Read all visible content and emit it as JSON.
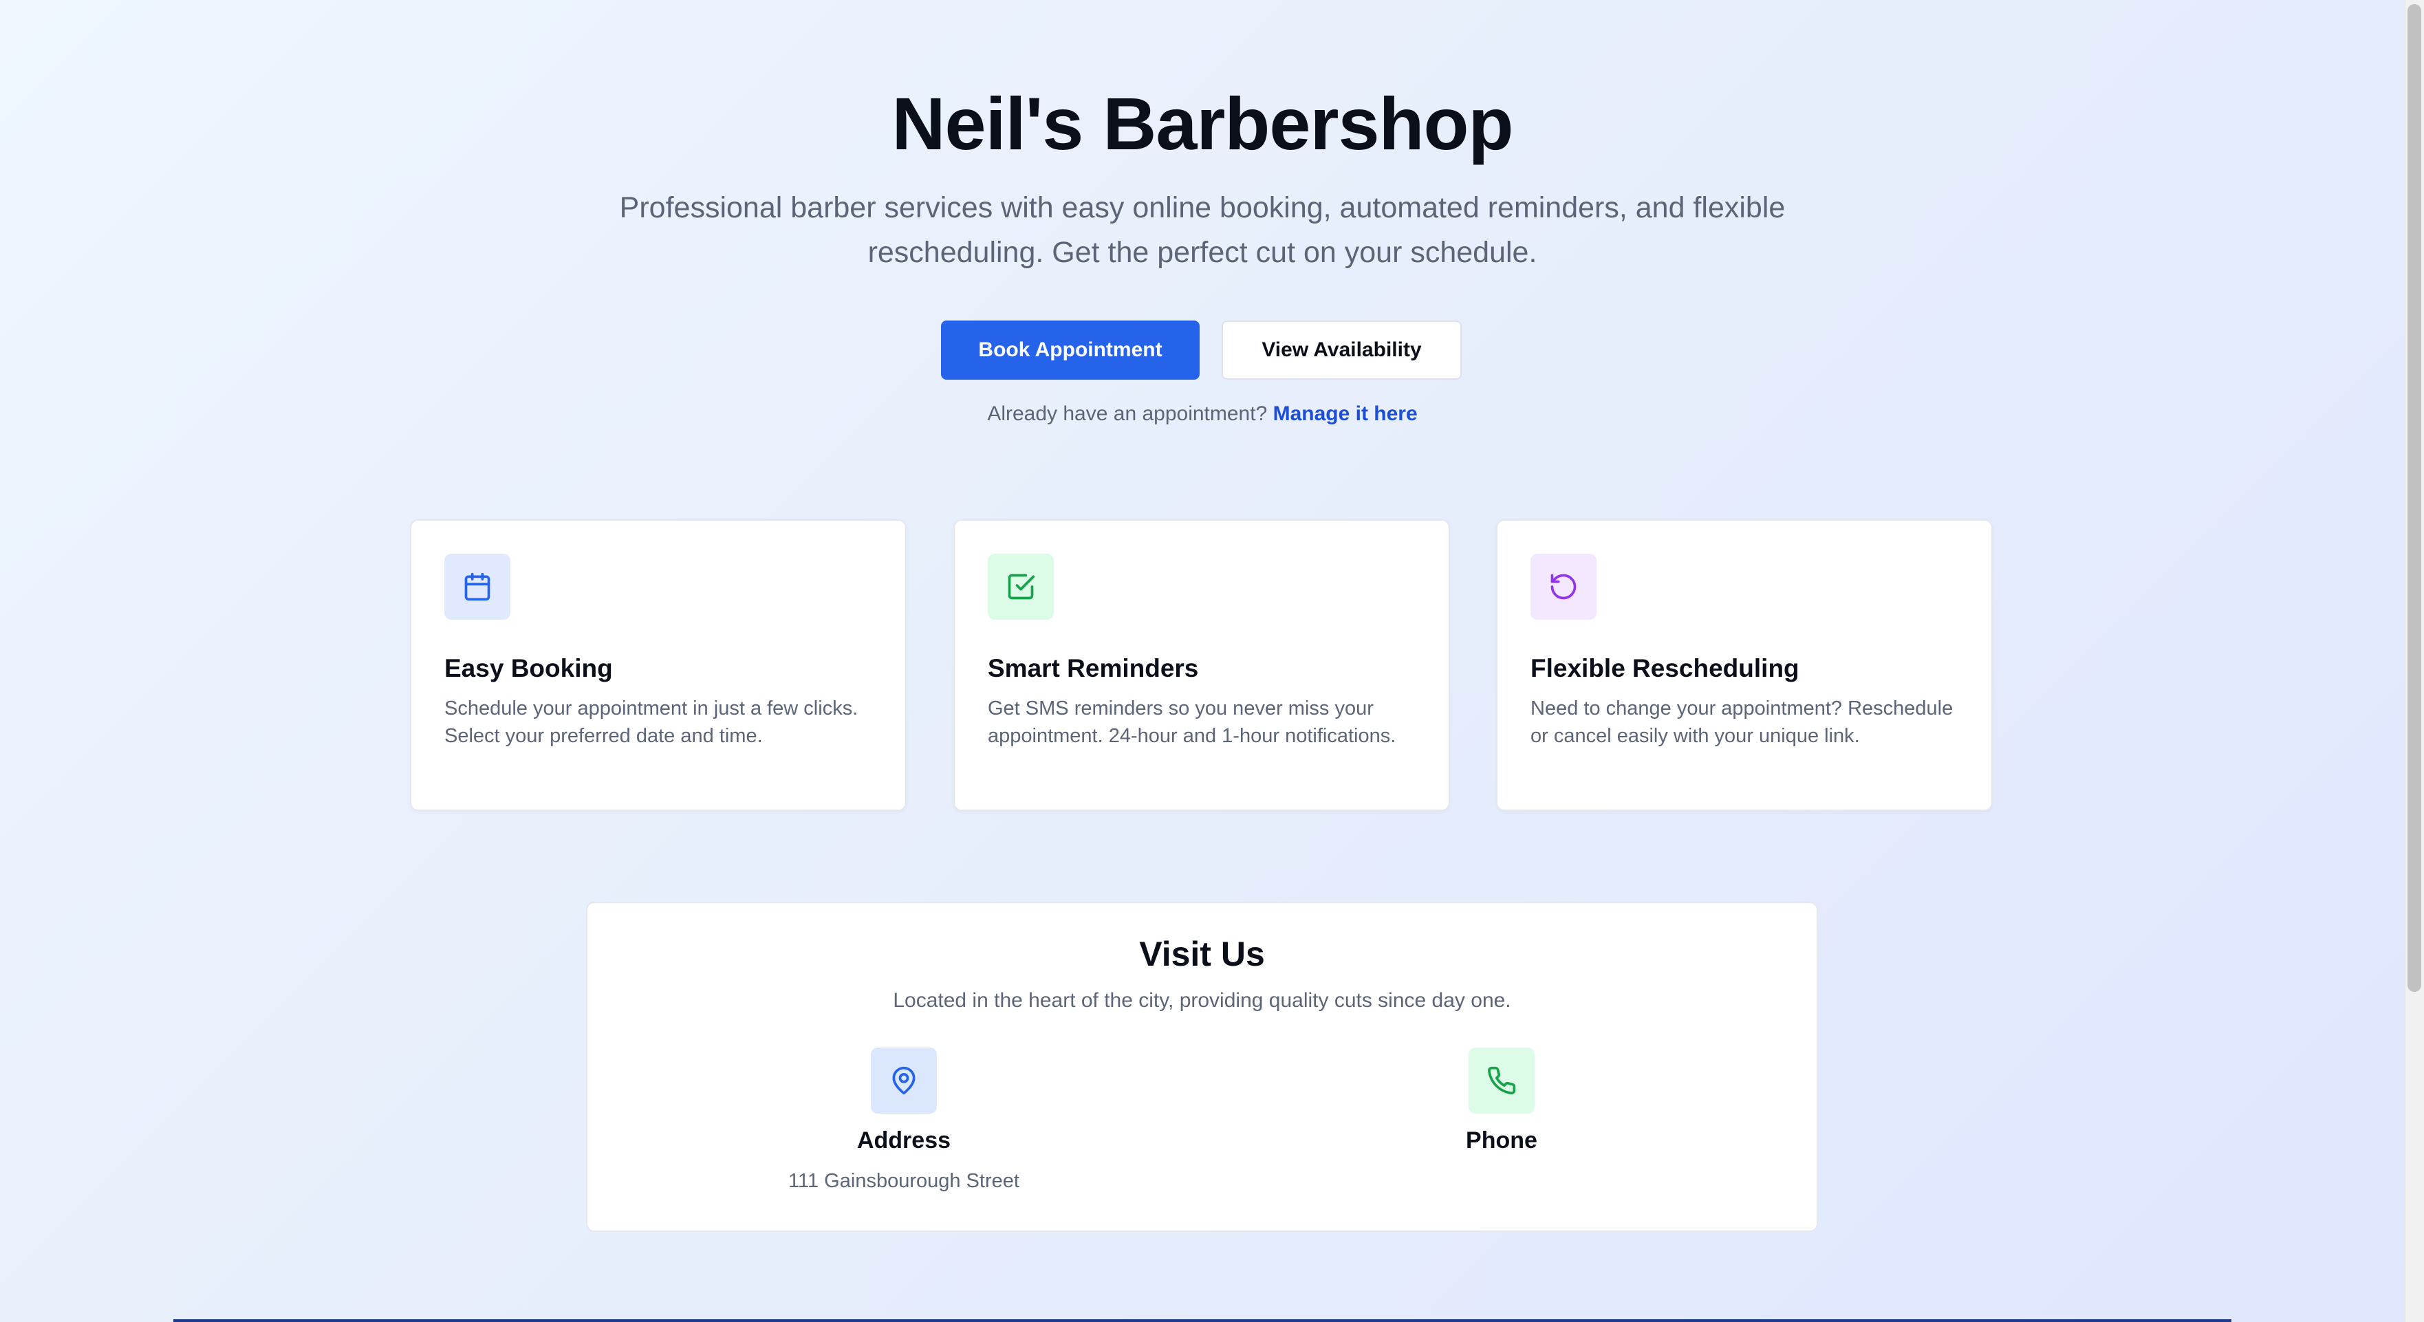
{
  "hero": {
    "title": "Neil's Barbershop",
    "subtitle": "Professional barber services with easy online booking, automated reminders, and flexible rescheduling. Get the perfect cut on your schedule.",
    "primary_button": "Book Appointment",
    "secondary_button": "View Availability",
    "manage_prompt": "Already have an appointment?",
    "manage_link": "Manage it here"
  },
  "features": [
    {
      "icon": "calendar-icon",
      "title": "Easy Booking",
      "description": "Schedule your appointment in just a few clicks. Select your preferred date and time.",
      "icon_bg": "#e0e9fd",
      "icon_color": "#2563eb"
    },
    {
      "icon": "check-square-icon",
      "title": "Smart Reminders",
      "description": "Get SMS reminders so you never miss your appointment. 24-hour and 1-hour notifications.",
      "icon_bg": "#dcfce7",
      "icon_color": "#16a34a"
    },
    {
      "icon": "rotate-ccw-icon",
      "title": "Flexible Rescheduling",
      "description": "Need to change your appointment? Reschedule or cancel easily with your unique link.",
      "icon_bg": "#f3e8ff",
      "icon_color": "#9333ea"
    }
  ],
  "visit": {
    "title": "Visit Us",
    "subtitle": "Located in the heart of the city, providing quality cuts since day one.",
    "address_label": "Address",
    "address_value": "111 Gainsbourough Street",
    "phone_label": "Phone"
  },
  "colors": {
    "accent": "#2563eb",
    "link": "#1d4ed8",
    "muted_text": "#5b6577"
  }
}
